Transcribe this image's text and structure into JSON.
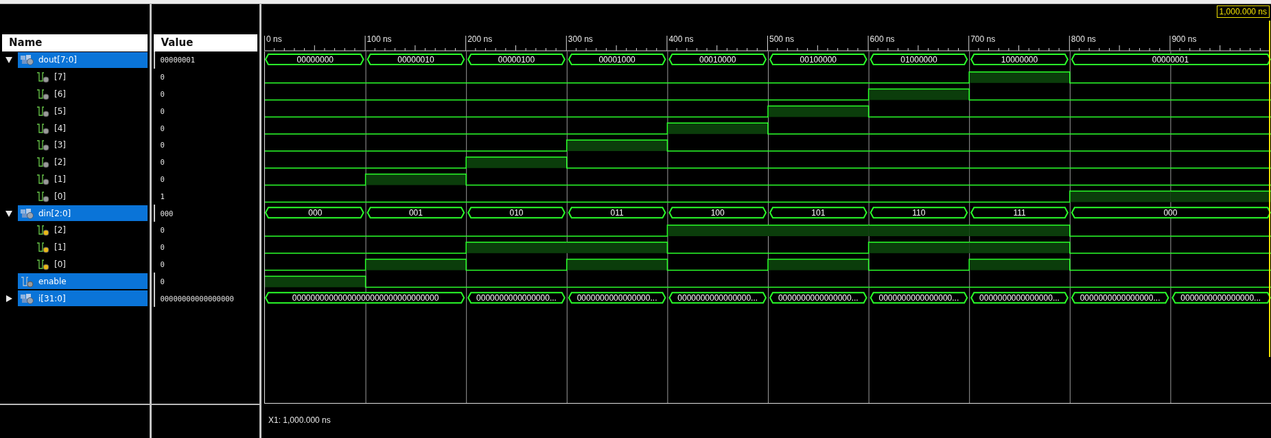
{
  "cursor": {
    "label": "1,000.000 ns"
  },
  "columns": {
    "name": "Name",
    "value": "Value"
  },
  "ruler": {
    "labels": [
      "0 ns",
      "100 ns",
      "200 ns",
      "300 ns",
      "400 ns",
      "500 ns",
      "600 ns",
      "700 ns",
      "800 ns",
      "900 ns"
    ]
  },
  "signals": [
    {
      "name": "dout[7:0]",
      "value": "00000001",
      "kind": "bus",
      "expanded": true,
      "selected": true,
      "segments": [
        {
          "value": "00000000",
          "wide": false
        },
        {
          "value": "00000010",
          "wide": false
        },
        {
          "value": "00000100",
          "wide": false
        },
        {
          "value": "00001000",
          "wide": false
        },
        {
          "value": "00010000",
          "wide": false
        },
        {
          "value": "00100000",
          "wide": false
        },
        {
          "value": "01000000",
          "wide": false
        },
        {
          "value": "10000000",
          "wide": false
        },
        {
          "value": "00000001",
          "wide": true
        }
      ],
      "children": [
        {
          "name": "[7]",
          "value": "0",
          "kind": "bit",
          "input": false,
          "selected": false,
          "high": [
            false,
            false,
            false,
            false,
            false,
            false,
            false,
            true,
            false,
            false
          ]
        },
        {
          "name": "[6]",
          "value": "0",
          "kind": "bit",
          "input": false,
          "selected": false,
          "high": [
            false,
            false,
            false,
            false,
            false,
            false,
            true,
            false,
            false,
            false
          ]
        },
        {
          "name": "[5]",
          "value": "0",
          "kind": "bit",
          "input": false,
          "selected": false,
          "high": [
            false,
            false,
            false,
            false,
            false,
            true,
            false,
            false,
            false,
            false
          ]
        },
        {
          "name": "[4]",
          "value": "0",
          "kind": "bit",
          "input": false,
          "selected": false,
          "high": [
            false,
            false,
            false,
            false,
            true,
            false,
            false,
            false,
            false,
            false
          ]
        },
        {
          "name": "[3]",
          "value": "0",
          "kind": "bit",
          "input": false,
          "selected": false,
          "high": [
            false,
            false,
            false,
            true,
            false,
            false,
            false,
            false,
            false,
            false
          ]
        },
        {
          "name": "[2]",
          "value": "0",
          "kind": "bit",
          "input": false,
          "selected": false,
          "high": [
            false,
            false,
            true,
            false,
            false,
            false,
            false,
            false,
            false,
            false
          ]
        },
        {
          "name": "[1]",
          "value": "0",
          "kind": "bit",
          "input": false,
          "selected": false,
          "high": [
            false,
            true,
            false,
            false,
            false,
            false,
            false,
            false,
            false,
            false
          ]
        },
        {
          "name": "[0]",
          "value": "1",
          "kind": "bit",
          "input": false,
          "selected": false,
          "high": [
            false,
            false,
            false,
            false,
            false,
            false,
            false,
            false,
            true,
            true
          ]
        }
      ]
    },
    {
      "name": "din[2:0]",
      "value": "000",
      "kind": "bus",
      "expanded": true,
      "selected": true,
      "segments": [
        {
          "value": "000",
          "wide": false
        },
        {
          "value": "001",
          "wide": false
        },
        {
          "value": "010",
          "wide": false
        },
        {
          "value": "011",
          "wide": false
        },
        {
          "value": "100",
          "wide": false
        },
        {
          "value": "101",
          "wide": false
        },
        {
          "value": "110",
          "wide": false
        },
        {
          "value": "111",
          "wide": false
        },
        {
          "value": "000",
          "wide": true
        }
      ],
      "children": [
        {
          "name": "[2]",
          "value": "0",
          "kind": "bit",
          "input": true,
          "selected": false,
          "high": [
            false,
            false,
            false,
            false,
            true,
            true,
            true,
            true,
            false,
            false
          ]
        },
        {
          "name": "[1]",
          "value": "0",
          "kind": "bit",
          "input": true,
          "selected": false,
          "high": [
            false,
            false,
            true,
            true,
            false,
            false,
            true,
            true,
            false,
            false
          ]
        },
        {
          "name": "[0]",
          "value": "0",
          "kind": "bit",
          "input": true,
          "selected": false,
          "high": [
            false,
            true,
            false,
            true,
            false,
            true,
            false,
            true,
            false,
            false
          ]
        }
      ]
    },
    {
      "name": "enable",
      "value": "0",
      "kind": "bit",
      "input": false,
      "selected": true,
      "high": [
        true,
        false,
        false,
        false,
        false,
        false,
        false,
        false,
        false,
        false
      ]
    },
    {
      "name": "i[31:0]",
      "value": "00000000000000000",
      "kind": "bus",
      "expanded": false,
      "selected": true,
      "segments": [
        {
          "value": "00000000000000000000000000000000",
          "wide": true
        },
        {
          "value": "0000000000000000...",
          "wide": false
        },
        {
          "value": "0000000000000000...",
          "wide": false
        },
        {
          "value": "0000000000000000...",
          "wide": false
        },
        {
          "value": "0000000000000000...",
          "wide": false
        },
        {
          "value": "0000000000000000...",
          "wide": false
        },
        {
          "value": "0000000000000000...",
          "wide": false
        },
        {
          "value": "0000000000000000...",
          "wide": false
        },
        {
          "value": "0000000000000000...",
          "wide": false
        }
      ]
    }
  ],
  "status": "X1: 1,000.000 ns"
}
